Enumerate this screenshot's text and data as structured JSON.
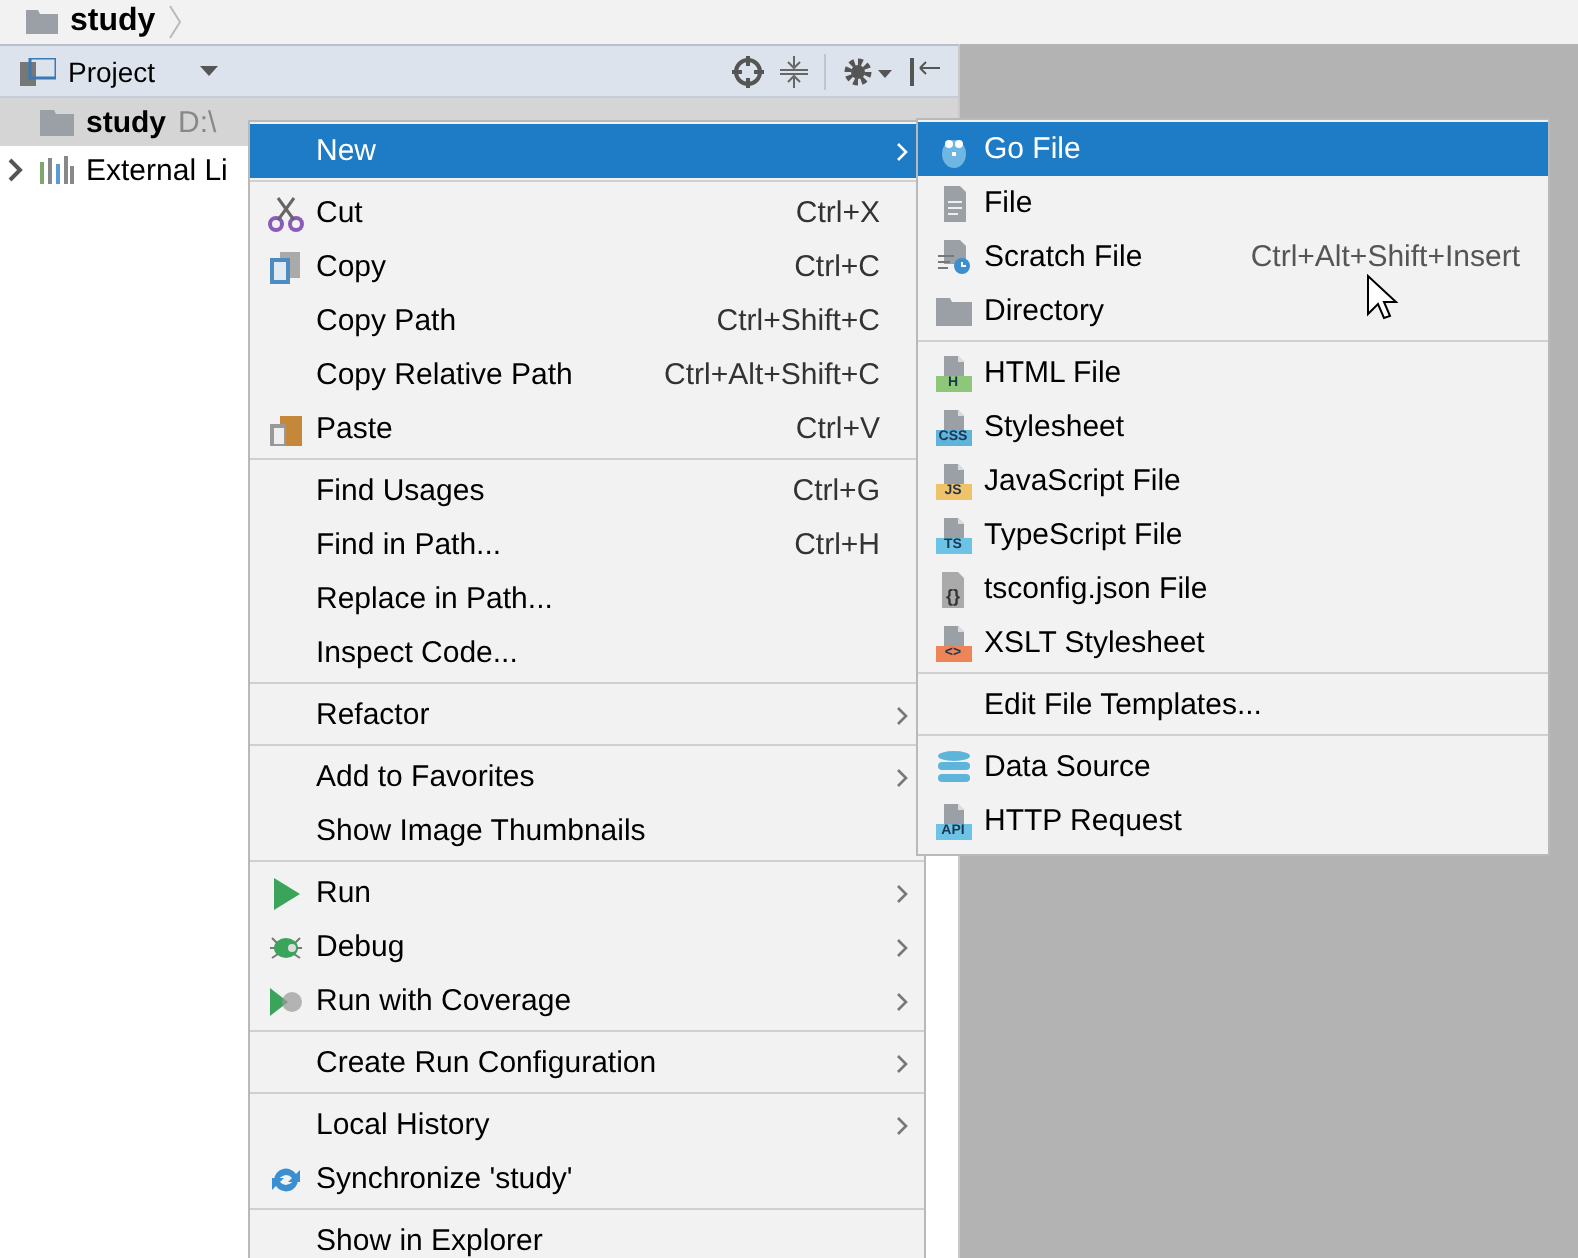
{
  "breadcrumb": {
    "label": "study"
  },
  "project_panel": {
    "title": "Project",
    "tree": [
      {
        "label": "study",
        "path": "D:\\",
        "selected": true,
        "expanded": true
      },
      {
        "label": "External Li",
        "selected": false,
        "expanded": false
      }
    ]
  },
  "context_menu": {
    "groups": [
      [
        {
          "label": "New",
          "has_submenu": true,
          "selected": true
        }
      ],
      [
        {
          "label": "Cut",
          "shortcut": "Ctrl+X",
          "has_submenu": false,
          "selected": false
        },
        {
          "label": "Copy",
          "shortcut": "Ctrl+C",
          "has_submenu": false,
          "selected": false
        },
        {
          "label": "Copy Path",
          "shortcut": "Ctrl+Shift+C",
          "has_submenu": false,
          "selected": false
        },
        {
          "label": "Copy Relative Path",
          "shortcut": "Ctrl+Alt+Shift+C",
          "has_submenu": false,
          "selected": false
        },
        {
          "label": "Paste",
          "shortcut": "Ctrl+V",
          "has_submenu": false,
          "selected": false
        }
      ],
      [
        {
          "label": "Find Usages",
          "shortcut": "Ctrl+G",
          "has_submenu": false,
          "selected": false
        },
        {
          "label": "Find in Path...",
          "shortcut": "Ctrl+H",
          "has_submenu": false,
          "selected": false
        },
        {
          "label": "Replace in Path...",
          "has_submenu": false,
          "selected": false
        },
        {
          "label": "Inspect Code...",
          "has_submenu": false,
          "selected": false
        }
      ],
      [
        {
          "label": "Refactor",
          "has_submenu": true,
          "selected": false
        }
      ],
      [
        {
          "label": "Add to Favorites",
          "has_submenu": true,
          "selected": false
        },
        {
          "label": "Show Image Thumbnails",
          "has_submenu": false,
          "selected": false
        }
      ],
      [
        {
          "label": "Run",
          "has_submenu": true,
          "selected": false
        },
        {
          "label": "Debug",
          "has_submenu": true,
          "selected": false
        },
        {
          "label": "Run with Coverage",
          "has_submenu": true,
          "selected": false
        }
      ],
      [
        {
          "label": "Create Run Configuration",
          "has_submenu": true,
          "selected": false
        }
      ],
      [
        {
          "label": "Local History",
          "has_submenu": true,
          "selected": false
        },
        {
          "label": "Synchronize 'study'",
          "has_submenu": false,
          "selected": false
        }
      ],
      [
        {
          "label": "Show in Explorer",
          "has_submenu": false,
          "selected": false
        }
      ]
    ]
  },
  "submenu": {
    "groups": [
      [
        {
          "label": "Go File",
          "selected": true
        },
        {
          "label": "File",
          "selected": false
        },
        {
          "label": "Scratch File",
          "shortcut": "Ctrl+Alt+Shift+Insert",
          "selected": false
        },
        {
          "label": "Directory",
          "selected": false
        }
      ],
      [
        {
          "label": "HTML File",
          "badge": "H",
          "color": "#8fc77a",
          "selected": false
        },
        {
          "label": "Stylesheet",
          "badge": "CSS",
          "color": "#5fb4dc",
          "selected": false
        },
        {
          "label": "JavaScript File",
          "badge": "JS",
          "color": "#f0c36a",
          "selected": false
        },
        {
          "label": "TypeScript File",
          "badge": "TS",
          "color": "#6cc3e6",
          "selected": false
        },
        {
          "label": "tsconfig.json File",
          "badge": "{}",
          "selected": false
        },
        {
          "label": "XSLT Stylesheet",
          "badge": "<>",
          "color": "#ee8557",
          "selected": false
        }
      ],
      [
        {
          "label": "Edit File Templates...",
          "selected": false
        }
      ],
      [
        {
          "label": "Data Source",
          "selected": false
        },
        {
          "label": "HTTP Request",
          "badge": "API",
          "color": "#6cc3e6",
          "selected": false
        }
      ]
    ]
  }
}
